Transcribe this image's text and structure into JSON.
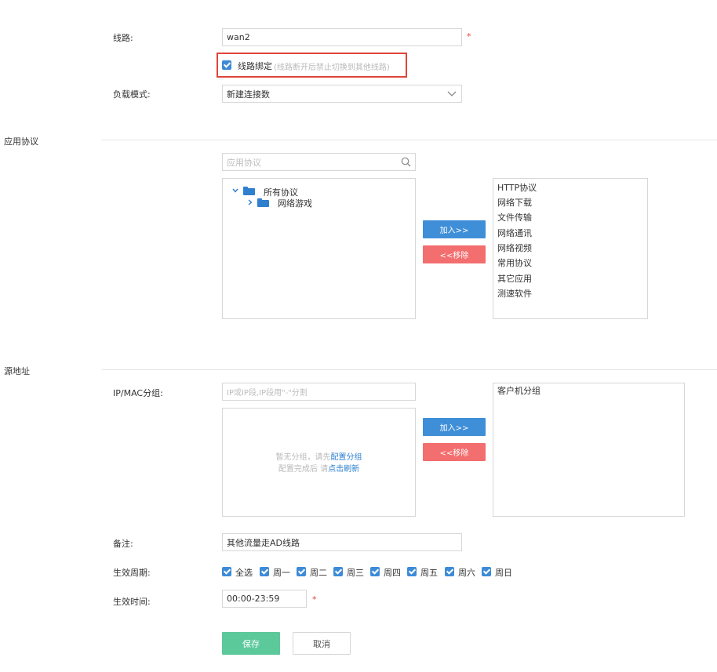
{
  "form": {
    "line_label": "线路:",
    "line_value": "wan2",
    "required_mark": "*",
    "bind_label": "线路绑定",
    "bind_hint": "(线路断开后禁止切换到其他线路)",
    "load_mode_label": "负载模式:",
    "load_mode_value": "新建连接数"
  },
  "app_protocol": {
    "section_title": "应用协议",
    "search_placeholder": "应用协议",
    "tree": {
      "root": "所有协议",
      "child": "网络游戏"
    },
    "add_button": "加入>>",
    "remove_button": "<<移除",
    "selected": [
      "HTTP协议",
      "网络下载",
      "文件传输",
      "网络通讯",
      "网络视频",
      "常用协议",
      "其它应用",
      "测速软件"
    ]
  },
  "source": {
    "section_title": "源地址",
    "ipmac_label": "IP/MAC分组:",
    "ipmac_placeholder": "IP或IP段,IP段用\"-\"分割",
    "empty_line1_prefix": "暂无分组，请先",
    "empty_line1_link": "配置分组",
    "empty_line2_prefix": "配置完成后 请",
    "empty_line2_link": "点击刷新",
    "add_button": "加入>>",
    "remove_button": "<<移除",
    "selected": [
      "客户机分组"
    ]
  },
  "extra": {
    "remark_label": "备注:",
    "remark_value": "其他流量走AD线路",
    "period_label": "生效周期:",
    "days": [
      "全选",
      "周一",
      "周二",
      "周三",
      "周四",
      "周五",
      "周六",
      "周日"
    ],
    "time_label": "生效时间:",
    "time_value": "00:00-23:59"
  },
  "actions": {
    "save": "保存",
    "cancel": "取消"
  },
  "colors": {
    "accent_blue": "#3f8fd8",
    "remove_red": "#f36e6e",
    "save_green": "#5cc99b",
    "highlight_red": "#e0443a",
    "link_blue": "#2a7fd0"
  }
}
